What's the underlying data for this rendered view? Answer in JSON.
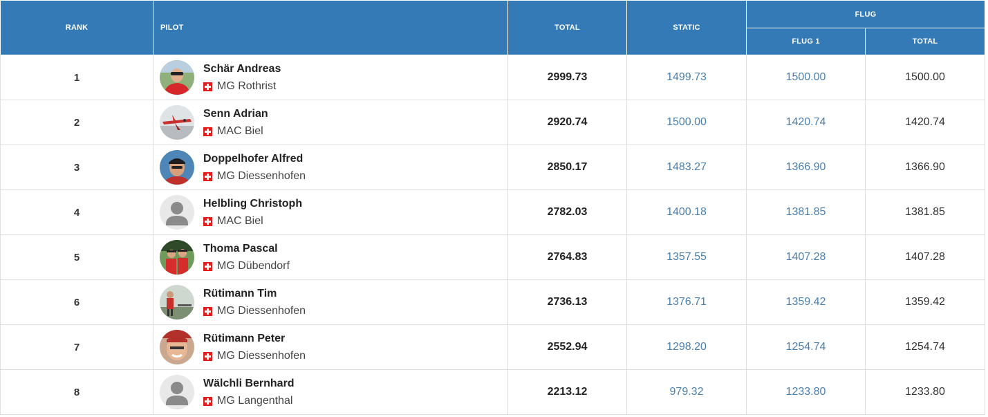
{
  "header": {
    "rank": "RANK",
    "pilot": "PILOT",
    "total": "TOTAL",
    "static": "STATIC",
    "flug": "FLUG",
    "flug1": "FLUG 1",
    "flug_total": "TOTAL"
  },
  "colors": {
    "header_bg": "#337ab7",
    "link_text": "#4a7fae",
    "swiss_red": "#e11c1c"
  },
  "rows": [
    {
      "rank": "1",
      "name": "Schär Andreas",
      "club": "MG Rothrist",
      "total": "2999.73",
      "static": "1499.73",
      "flug1": "1500.00",
      "flug_total": "1500.00",
      "avatar": "photo-red-jacket"
    },
    {
      "rank": "2",
      "name": "Senn Adrian",
      "club": "MAC Biel",
      "total": "2920.74",
      "static": "1500.00",
      "flug1": "1420.74",
      "flug_total": "1420.74",
      "avatar": "photo-airplane"
    },
    {
      "rank": "3",
      "name": "Doppelhofer Alfred",
      "club": "MG Diessenhofen",
      "total": "2850.17",
      "static": "1483.27",
      "flug1": "1366.90",
      "flug_total": "1366.90",
      "avatar": "photo-cap-man"
    },
    {
      "rank": "4",
      "name": "Helbling Christoph",
      "club": "MAC Biel",
      "total": "2782.03",
      "static": "1400.18",
      "flug1": "1381.85",
      "flug_total": "1381.85",
      "avatar": "placeholder-person"
    },
    {
      "rank": "5",
      "name": "Thoma Pascal",
      "club": "MG Dübendorf",
      "total": "2764.83",
      "static": "1357.55",
      "flug1": "1407.28",
      "flug_total": "1407.28",
      "avatar": "photo-two-people"
    },
    {
      "rank": "6",
      "name": "Rütimann Tim",
      "club": "MG Diessenhofen",
      "total": "2736.13",
      "static": "1376.71",
      "flug1": "1359.42",
      "flug_total": "1359.42",
      "avatar": "photo-field"
    },
    {
      "rank": "7",
      "name": "Rütimann Peter",
      "club": "MG Diessenhofen",
      "total": "2552.94",
      "static": "1298.20",
      "flug1": "1254.74",
      "flug_total": "1254.74",
      "avatar": "photo-face"
    },
    {
      "rank": "8",
      "name": "Wälchli Bernhard",
      "club": "MG Langenthal",
      "total": "2213.12",
      "static": "979.32",
      "flug1": "1233.80",
      "flug_total": "1233.80",
      "avatar": "placeholder-person"
    }
  ]
}
